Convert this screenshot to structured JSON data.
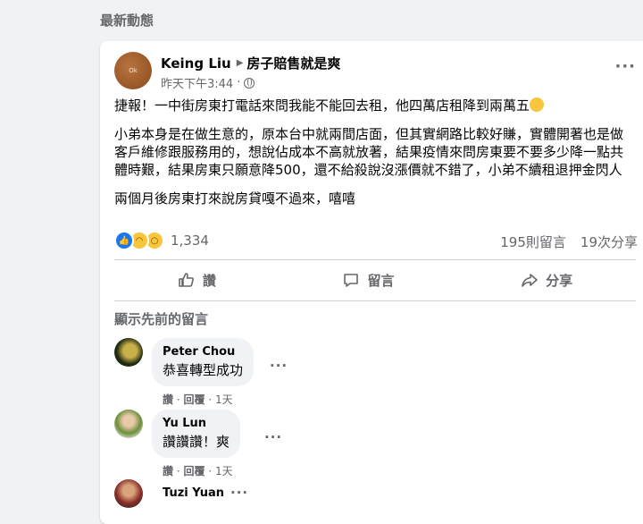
{
  "section_title": "最新動態",
  "post": {
    "avatar_text": "Ok",
    "author": "Keing Liu",
    "group": "房子賠售就是爽",
    "time": "昨天下午3:44",
    "time_separator": "·",
    "paragraphs": [
      "捷報！一中街房東打電話來問我能不能回去租，他四萬店租降到兩萬五",
      "小弟本身是在做生意的，原本台中就兩間店面，但其實網路比較好賺，實體開著也是做客戶維修跟服務用的，想說佔成本不高就放著，結果疫情來問房東要不要多少降一點共體時艱，結果房東只願意降500，還不給殺說沒漲價就不錯了，小弟不續租退押金閃人",
      "兩個月後房東打來說房貸嘎不過來，嘻嘻"
    ],
    "reaction_count": "1,334",
    "comments_count": "195則留言",
    "shares_count": "19次分享",
    "actions": {
      "like": "讚",
      "comment": "留言",
      "share": "分享"
    }
  },
  "view_previous": "顯示先前的留言",
  "comments": [
    {
      "name": "Peter Chou",
      "text": "恭喜轉型成功",
      "like": "讚",
      "reply": "回覆",
      "time": "1天"
    },
    {
      "name": "Yu Lun",
      "text": "讚讚讚！爽",
      "like": "讚",
      "reply": "回覆",
      "time": "1天"
    },
    {
      "name": "Tuzi Yuan",
      "text": "",
      "like": "",
      "reply": "",
      "time": ""
    }
  ],
  "colors": {
    "background": "#f0f2f5",
    "secondary_text": "#65676b",
    "like_blue": "#1877f2"
  },
  "icons": [
    "dots-menu-icon",
    "globe-icon",
    "like-reaction-icon",
    "haha-reaction-icon",
    "wow-reaction-icon",
    "thumbs-up-icon",
    "comment-icon",
    "share-icon"
  ]
}
